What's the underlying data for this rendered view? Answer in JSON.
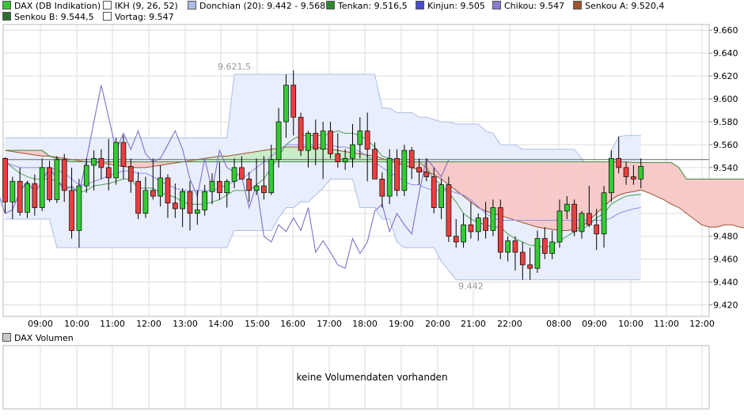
{
  "legend": [
    {
      "label": "DAX (DB Indikation)",
      "color": "#39c439"
    },
    {
      "label": "IKH (9, 26, 52)",
      "color": "#ffffff"
    },
    {
      "label": "Donchian (20): 9.442 - 9.568",
      "color": "#a9c0e6"
    },
    {
      "label": "Tenkan: 9.516,5",
      "color": "#2e8b2e"
    },
    {
      "label": "Kinjun: 9.505",
      "color": "#4a4ad4"
    },
    {
      "label": "Chikou: 9.547",
      "color": "#8a7ad0"
    },
    {
      "label": "Senkou A: 9.520,4",
      "color": "#a0522d"
    },
    {
      "label": "Senkou B: 9.544,5",
      "color": "#2e6e2e"
    },
    {
      "label": "Vortag: 9.547",
      "color": "#ffffff"
    }
  ],
  "colors": {
    "up": "#33cc33",
    "down": "#e84040",
    "donchian_fill": "#e8eefc",
    "donchian_line": "#a9c0e6",
    "tenkan": "#4fa04f",
    "kijun": "#8f8fe8",
    "chikou": "#8070c8",
    "senkou_a": "#a0522d",
    "senkou_b": "#3a8a3a",
    "cloud_bull": "#c9ecc9",
    "cloud_bear": "#f7caca",
    "grid": "#dcdcdc",
    "vortag": "#666666"
  },
  "chart_data": {
    "type": "candlestick",
    "y_ticks": [
      "9.660",
      "9.640",
      "9.620",
      "9.600",
      "9.580",
      "9.560",
      "9.540",
      "9.520",
      "9.500",
      "9.480",
      "9.460",
      "9.440",
      "9.420"
    ],
    "ylim": [
      9410,
      9665
    ],
    "x_ticks": [
      "09:00",
      "10:00",
      "11:00",
      "12:00",
      "13:00",
      "14:00",
      "15:00",
      "16:00",
      "17:00",
      "18:00",
      "19:00",
      "20:00",
      "21:00",
      "22:00",
      "08:00",
      "09:00",
      "10:00",
      "11:00",
      "12:00"
    ],
    "grid": true,
    "vortag": 9547,
    "annotations": [
      {
        "label": "9.621,5",
        "value": 9621.5,
        "candle": 31
      },
      {
        "label": "9.442",
        "value": 9442,
        "candle": 63
      }
    ],
    "candles": [
      [
        9548,
        9549,
        9500,
        9510
      ],
      [
        9510,
        9532,
        9495,
        9528
      ],
      [
        9528,
        9540,
        9498,
        9501
      ],
      [
        9501,
        9528,
        9496,
        9526
      ],
      [
        9526,
        9534,
        9498,
        9505
      ],
      [
        9505,
        9548,
        9502,
        9540
      ],
      [
        9540,
        9546,
        9510,
        9512
      ],
      [
        9512,
        9550,
        9509,
        9547
      ],
      [
        9547,
        9552,
        9510,
        9520
      ],
      [
        9520,
        9540,
        9478,
        9485
      ],
      [
        9485,
        9530,
        9470,
        9524
      ],
      [
        9524,
        9548,
        9518,
        9542
      ],
      [
        9542,
        9555,
        9520,
        9548
      ],
      [
        9548,
        9556,
        9530,
        9540
      ],
      [
        9540,
        9565,
        9520,
        9531
      ],
      [
        9531,
        9566,
        9525,
        9562
      ],
      [
        9562,
        9568,
        9530,
        9541
      ],
      [
        9541,
        9548,
        9518,
        9528
      ],
      [
        9528,
        9536,
        9495,
        9500
      ],
      [
        9500,
        9532,
        9496,
        9520
      ],
      [
        9520,
        9548,
        9512,
        9515
      ],
      [
        9515,
        9542,
        9506,
        9531
      ],
      [
        9531,
        9534,
        9496,
        9509
      ],
      [
        9509,
        9526,
        9496,
        9504
      ],
      [
        9504,
        9522,
        9488,
        9519
      ],
      [
        9519,
        9528,
        9485,
        9500
      ],
      [
        9500,
        9520,
        9490,
        9503
      ],
      [
        9503,
        9525,
        9498,
        9519
      ],
      [
        9519,
        9535,
        9508,
        9528
      ],
      [
        9528,
        9545,
        9512,
        9518
      ],
      [
        9518,
        9530,
        9505,
        9528
      ],
      [
        9528,
        9548,
        9522,
        9540
      ],
      [
        9540,
        9550,
        9530,
        9530
      ],
      [
        9530,
        9536,
        9510,
        9520
      ],
      [
        9520,
        9548,
        9516,
        9524
      ],
      [
        9524,
        9550,
        9512,
        9518
      ],
      [
        9518,
        9560,
        9516,
        9547
      ],
      [
        9547,
        9592,
        9540,
        9580
      ],
      [
        9580,
        9621.5,
        9566,
        9612
      ],
      [
        9612,
        9625,
        9568,
        9584
      ],
      [
        9584,
        9588,
        9550,
        9555
      ],
      [
        9555,
        9572,
        9540,
        9570
      ],
      [
        9570,
        9582,
        9542,
        9556
      ],
      [
        9556,
        9580,
        9530,
        9572
      ],
      [
        9572,
        9580,
        9548,
        9552
      ],
      [
        9552,
        9570,
        9540,
        9545
      ],
      [
        9545,
        9556,
        9538,
        9548
      ],
      [
        9548,
        9578,
        9540,
        9560
      ],
      [
        9560,
        9584,
        9548,
        9572
      ],
      [
        9572,
        9588,
        9528,
        9556
      ],
      [
        9556,
        9562,
        9532,
        9530
      ],
      [
        9530,
        9536,
        9505,
        9515
      ],
      [
        9515,
        9556,
        9508,
        9548
      ],
      [
        9548,
        9556,
        9515,
        9520
      ],
      [
        9520,
        9560,
        9515,
        9555
      ],
      [
        9555,
        9558,
        9530,
        9540
      ],
      [
        9540,
        9548,
        9525,
        9536
      ],
      [
        9536,
        9548,
        9528,
        9532
      ],
      [
        9532,
        9540,
        9500,
        9505
      ],
      [
        9505,
        9530,
        9495,
        9525
      ],
      [
        9525,
        9532,
        9475,
        9480
      ],
      [
        9480,
        9495,
        9470,
        9475
      ],
      [
        9475,
        9500,
        9470,
        9490
      ],
      [
        9490,
        9510,
        9478,
        9484
      ],
      [
        9484,
        9500,
        9476,
        9496
      ],
      [
        9496,
        9510,
        9478,
        9485
      ],
      [
        9485,
        9512,
        9480,
        9505
      ],
      [
        9505,
        9512,
        9460,
        9466
      ],
      [
        9466,
        9480,
        9458,
        9476
      ],
      [
        9476,
        9480,
        9450,
        9466
      ],
      [
        9466,
        9475,
        9442,
        9455
      ],
      [
        9455,
        9470,
        9442,
        9452
      ],
      [
        9452,
        9485,
        9448,
        9478
      ],
      [
        9478,
        9488,
        9460,
        9465
      ],
      [
        9465,
        9485,
        9460,
        9475
      ],
      [
        9475,
        9512,
        9470,
        9502
      ],
      [
        9502,
        9515,
        9495,
        9508
      ],
      [
        9508,
        9512,
        9480,
        9484
      ],
      [
        9484,
        9502,
        9478,
        9500
      ],
      [
        9500,
        9524,
        9488,
        9490
      ],
      [
        9490,
        9504,
        9468,
        9482
      ],
      [
        9482,
        9524,
        9470,
        9518
      ],
      [
        9518,
        9555,
        9510,
        9548
      ],
      [
        9548,
        9567,
        9535,
        9540
      ],
      [
        9540,
        9545,
        9525,
        9532
      ],
      [
        9532,
        9542,
        9525,
        9530
      ],
      [
        9530,
        9548,
        9522,
        9541
      ]
    ],
    "series": [
      {
        "name": "Tenkan",
        "values": [
          9545,
          9540,
          9535,
          9532,
          9530,
          9530,
          9530,
          9528,
          9524,
          9522,
          9518,
          9520,
          9524,
          9525,
          9526,
          9528,
          9530,
          9530,
          9522,
          9522,
          9522,
          9518,
          9516,
          9514,
          9510,
          9508,
          9508,
          9508,
          9510,
          9512,
          9516,
          9520,
          9520,
          9520,
          9525,
          9530,
          9540,
          9550,
          9560,
          9565,
          9568,
          9568,
          9568,
          9568,
          9570,
          9572,
          9570,
          9570,
          9568,
          9564,
          9558,
          9550,
          9548,
          9545,
          9545,
          9545,
          9545,
          9540,
          9530,
          9525,
          9518,
          9510,
          9500,
          9495,
          9492,
          9490,
          9488,
          9488,
          9482,
          9478,
          9475,
          9472,
          9472,
          9470,
          9472,
          9476,
          9480,
          9484,
          9486,
          9490,
          9496,
          9500,
          9508,
          9512,
          9515,
          9516,
          9516.5
        ]
      },
      {
        "name": "Kinjun",
        "values": [
          9545,
          9542,
          9540,
          9540,
          9540,
          9540,
          9540,
          9538,
          9535,
          9530,
          9525,
          9525,
          9528,
          9530,
          9533,
          9535,
          9537,
          9537,
          9535,
          9535,
          9532,
          9528,
          9525,
          9522,
          9520,
          9520,
          9520,
          9520,
          9520,
          9522,
          9525,
          9528,
          9530,
          9535,
          9540,
          9545,
          9550,
          9555,
          9560,
          9560,
          9560,
          9560,
          9560,
          9560,
          9560,
          9558,
          9558,
          9556,
          9554,
          9550,
          9545,
          9540,
          9536,
          9532,
          9528,
          9525,
          9525,
          9522,
          9520,
          9520,
          9520,
          9518,
          9516,
          9512,
          9506,
          9500,
          9496,
          9494,
          9494,
          9494,
          9494,
          9494,
          9494,
          9494,
          9494,
          9494,
          9494,
          9494,
          9494,
          9494,
          9494,
          9494,
          9496,
          9500,
          9502,
          9504,
          9505
        ]
      },
      {
        "name": "Chikou",
        "values": [
          9548,
          9510,
          9528,
          9501,
          9526,
          9505,
          9540,
          9512,
          9547,
          9520,
          9485,
          9524,
          9542,
          9548,
          9540,
          9531,
          9562,
          9541,
          9528,
          9500,
          9520,
          9515,
          9531,
          9509,
          9504,
          9519,
          9500,
          9503,
          9519,
          9528,
          9518,
          9528,
          9540,
          9530,
          9520,
          9524,
          9518,
          9547,
          9580,
          9612,
          9584,
          9555,
          9570,
          9556,
          9572,
          9552,
          9545,
          9548,
          9560,
          9572,
          9556,
          9530,
          9515,
          9548,
          9520,
          9555,
          9540,
          9536,
          9532,
          9505,
          9525,
          9480,
          9475,
          9490,
          9484,
          9496,
          9485,
          9505,
          9466,
          9476,
          9466,
          9455,
          9452,
          9478,
          9465,
          9475,
          9502,
          9508,
          9484,
          9500,
          9490,
          9482,
          9518,
          9548,
          9540,
          9532,
          9547
        ]
      },
      {
        "name": "Senkou A",
        "values": [
          9555,
          9554,
          9553,
          9552,
          9551,
          9550,
          9550,
          9549,
          9548,
          9547,
          9546,
          9545,
          9545,
          9544,
          9543,
          9542,
          9541,
          9540,
          9540,
          9540,
          9541,
          9542,
          9543,
          9544,
          9545,
          9546,
          9547,
          9548,
          9549,
          9550,
          9550,
          9551,
          9552,
          9553,
          9554,
          9555,
          9556,
          9557,
          9558,
          9558,
          9558,
          9558,
          9558,
          9557,
          9556,
          9555,
          9554,
          9553,
          9552,
          9551,
          9550,
          9548,
          9546,
          9544,
          9542,
          9540,
          9538,
          9536,
          9534,
          9530,
          9525,
          9520,
          9515,
          9510,
          9505,
          9502,
          9500,
          9498,
          9496,
          9494,
          9492,
          9490,
          9488,
          9487,
          9486,
          9485,
          9485,
          9486,
          9488,
          9494,
          9500,
          9506,
          9512,
          9516,
          9518,
          9519,
          9520.4
        ]
      },
      {
        "name": "Senkou B",
        "values": [
          9555,
          9555,
          9555,
          9555,
          9555,
          9555,
          9550,
          9548,
          9546,
          9545,
          9545,
          9545,
          9545,
          9545,
          9545,
          9545,
          9545,
          9545,
          9545,
          9545,
          9545,
          9545,
          9545,
          9545,
          9545,
          9545,
          9545,
          9545,
          9545,
          9545,
          9545,
          9545,
          9545,
          9545,
          9545,
          9545,
          9545,
          9545,
          9545,
          9545,
          9545,
          9545,
          9545,
          9545,
          9545,
          9545,
          9545,
          9545,
          9545,
          9545,
          9545,
          9545,
          9545,
          9545,
          9545,
          9545,
          9545,
          9545,
          9545,
          9545,
          9545,
          9545,
          9545,
          9545,
          9545,
          9545,
          9545,
          9545,
          9545,
          9545,
          9545,
          9545,
          9545,
          9545,
          9545,
          9545,
          9545,
          9545,
          9545,
          9545,
          9545,
          9545,
          9545,
          9545,
          9545,
          9544.5,
          9544.5
        ]
      },
      {
        "name": "Donchian upper",
        "values": [
          9566,
          9566,
          9566,
          9566,
          9566,
          9566,
          9566,
          9566,
          9566,
          9566,
          9566,
          9566,
          9566,
          9566,
          9566,
          9566,
          9566,
          9566,
          9566,
          9566,
          9566,
          9566,
          9566,
          9566,
          9566,
          9566,
          9566,
          9566,
          9566,
          9566,
          9566,
          9621.5,
          9621.5,
          9621.5,
          9621.5,
          9621.5,
          9621.5,
          9621.5,
          9621.5,
          9621.5,
          9621.5,
          9621.5,
          9621.5,
          9621.5,
          9621.5,
          9621.5,
          9621.5,
          9621.5,
          9621.5,
          9621.5,
          9621.5,
          9592,
          9592,
          9588,
          9588,
          9588,
          9584,
          9584,
          9582,
          9580,
          9580,
          9578,
          9578,
          9578,
          9578,
          9572,
          9570,
          9560,
          9560,
          9560,
          9556,
          9556,
          9556,
          9556,
          9556,
          9556,
          9556,
          9556,
          9548,
          9540,
          9530,
          9530,
          9555,
          9567,
          9568,
          9568,
          9568
        ]
      },
      {
        "name": "Donchian lower",
        "values": [
          9495,
          9495,
          9495,
          9495,
          9495,
          9495,
          9495,
          9470,
          9470,
          9470,
          9470,
          9470,
          9470,
          9470,
          9470,
          9470,
          9470,
          9470,
          9470,
          9470,
          9470,
          9470,
          9470,
          9470,
          9470,
          9470,
          9470,
          9470,
          9470,
          9470,
          9470,
          9485,
          9485,
          9485,
          9485,
          9485,
          9485,
          9496,
          9505,
          9505,
          9510,
          9510,
          9516,
          9522,
          9530,
          9530,
          9530,
          9530,
          9505,
          9505,
          9505,
          9495,
          9495,
          9475,
          9470,
          9470,
          9470,
          9470,
          9470,
          9458,
          9450,
          9442,
          9442,
          9442,
          9442,
          9442,
          9442,
          9442,
          9442,
          9442,
          9442,
          9442,
          9442,
          9442,
          9442,
          9442,
          9442,
          9442,
          9442,
          9442,
          9442,
          9442,
          9442,
          9442,
          9442,
          9442,
          9442
        ]
      },
      {
        "name": "Cloud A future",
        "values": [
          9520.4,
          9518,
          9515,
          9512,
          9508,
          9505,
          9500,
          9495,
          9490,
          9488,
          9488,
          9490,
          9490,
          9488,
          9487,
          9490,
          9495,
          9505,
          9515,
          9520,
          9520,
          9520
        ]
      },
      {
        "name": "Cloud B future",
        "values": [
          9544.5,
          9544.5,
          9544.5,
          9544.5,
          9544.5,
          9540,
          9530,
          9530,
          9530,
          9530,
          9530,
          9530,
          9530,
          9530,
          9530,
          9530,
          9530,
          9530,
          9530,
          9510,
          9510,
          9510
        ]
      }
    ]
  },
  "volume_panel": {
    "title": "DAX Volumen",
    "message": "keine Volumendaten vorhanden"
  }
}
